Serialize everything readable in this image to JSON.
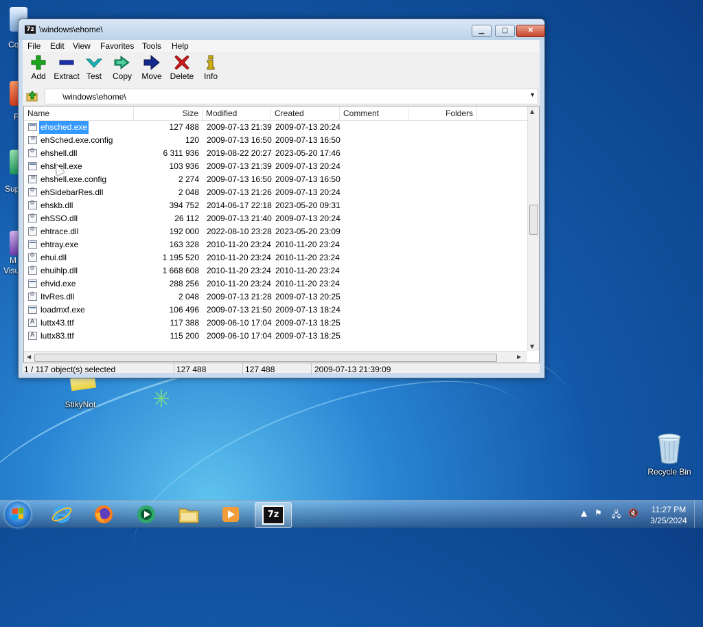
{
  "desktop": {
    "icons": [
      {
        "label": "StikyNot"
      },
      {
        "label": "Recycle Bin"
      }
    ],
    "partial_labels": [
      "Co",
      "F",
      "Sup",
      "M",
      "Visu"
    ]
  },
  "window": {
    "title": "\\windows\\ehome\\",
    "app_icon_text": "7z",
    "controls": {
      "min": "▁",
      "max": "▢",
      "close": "✕"
    }
  },
  "menu": [
    "File",
    "Edit",
    "View",
    "Favorites",
    "Tools",
    "Help"
  ],
  "toolbar": [
    {
      "label": "Add",
      "icon": "plus-icon",
      "color": "#1ea31e"
    },
    {
      "label": "Extract",
      "icon": "minus-icon",
      "color": "#1b2fa8"
    },
    {
      "label": "Test",
      "icon": "check-icon",
      "color": "#1bb5b5"
    },
    {
      "label": "Copy",
      "icon": "double-arrow-icon",
      "color": "#1a9a6a"
    },
    {
      "label": "Move",
      "icon": "arrow-right-icon",
      "color": "#142a8c"
    },
    {
      "label": "Delete",
      "icon": "x-icon",
      "color": "#d11a1a"
    },
    {
      "label": "Info",
      "icon": "info-icon",
      "color": "#d3b10f"
    }
  ],
  "address": {
    "path": "\\windows\\ehome\\"
  },
  "columns": [
    "Name",
    "Size",
    "Modified",
    "Created",
    "Comment",
    "Folders"
  ],
  "files": [
    {
      "name": "ehsched.exe",
      "type": "exe",
      "size": "127 488",
      "modified": "2009-07-13 21:39",
      "created": "2009-07-13 20:24",
      "selected": true
    },
    {
      "name": "ehSched.exe.config",
      "type": "cfg",
      "size": "120",
      "modified": "2009-07-13 16:50",
      "created": "2009-07-13 16:50"
    },
    {
      "name": "ehshell.dll",
      "type": "dll",
      "size": "6 311 936",
      "modified": "2019-08-22 20:27",
      "created": "2023-05-20 17:46"
    },
    {
      "name": "ehshell.exe",
      "type": "exe",
      "size": "103 936",
      "modified": "2009-07-13 21:39",
      "created": "2009-07-13 20:24"
    },
    {
      "name": "ehshell.exe.config",
      "type": "cfg",
      "size": "2 274",
      "modified": "2009-07-13 16:50",
      "created": "2009-07-13 16:50"
    },
    {
      "name": "ehSidebarRes.dll",
      "type": "dll",
      "size": "2 048",
      "modified": "2009-07-13 21:26",
      "created": "2009-07-13 20:24"
    },
    {
      "name": "ehskb.dll",
      "type": "dll",
      "size": "394 752",
      "modified": "2014-06-17 22:18",
      "created": "2023-05-20 09:31"
    },
    {
      "name": "ehSSO.dll",
      "type": "dll",
      "size": "26 112",
      "modified": "2009-07-13 21:40",
      "created": "2009-07-13 20:24"
    },
    {
      "name": "ehtrace.dll",
      "type": "dll",
      "size": "192 000",
      "modified": "2022-08-10 23:28",
      "created": "2023-05-20 23:09"
    },
    {
      "name": "ehtray.exe",
      "type": "exe",
      "size": "163 328",
      "modified": "2010-11-20 23:24",
      "created": "2010-11-20 23:24"
    },
    {
      "name": "ehui.dll",
      "type": "dll",
      "size": "1 195 520",
      "modified": "2010-11-20 23:24",
      "created": "2010-11-20 23:24"
    },
    {
      "name": "ehuihlp.dll",
      "type": "dll",
      "size": "1 668 608",
      "modified": "2010-11-20 23:24",
      "created": "2010-11-20 23:24"
    },
    {
      "name": "ehvid.exe",
      "type": "exe",
      "size": "288 256",
      "modified": "2010-11-20 23:24",
      "created": "2010-11-20 23:24"
    },
    {
      "name": "ItvRes.dll",
      "type": "dll",
      "size": "2 048",
      "modified": "2009-07-13 21:28",
      "created": "2009-07-13 20:25"
    },
    {
      "name": "loadmxf.exe",
      "type": "exe",
      "size": "106 496",
      "modified": "2009-07-13 21:50",
      "created": "2009-07-13 18:24"
    },
    {
      "name": "luttx43.ttf",
      "type": "ttf",
      "size": "117 388",
      "modified": "2009-06-10 17:04",
      "created": "2009-07-13 18:25"
    },
    {
      "name": "luttx83.ttf",
      "type": "ttf",
      "size": "115 200",
      "modified": "2009-06-10 17:04",
      "created": "2009-07-13 18:25"
    }
  ],
  "status": {
    "selection": "1 / 117 object(s) selected",
    "size": "127 488",
    "packed": "127 488",
    "date": "2009-07-13 21:39:09"
  },
  "taskbar": {
    "clock_time": "11:27 PM",
    "clock_date": "3/25/2024",
    "apps": [
      "internet-explorer-icon",
      "firefox-icon",
      "media-center-icon",
      "folder-icon",
      "media-player-icon",
      "7zip-icon"
    ],
    "active_label": "7z"
  }
}
